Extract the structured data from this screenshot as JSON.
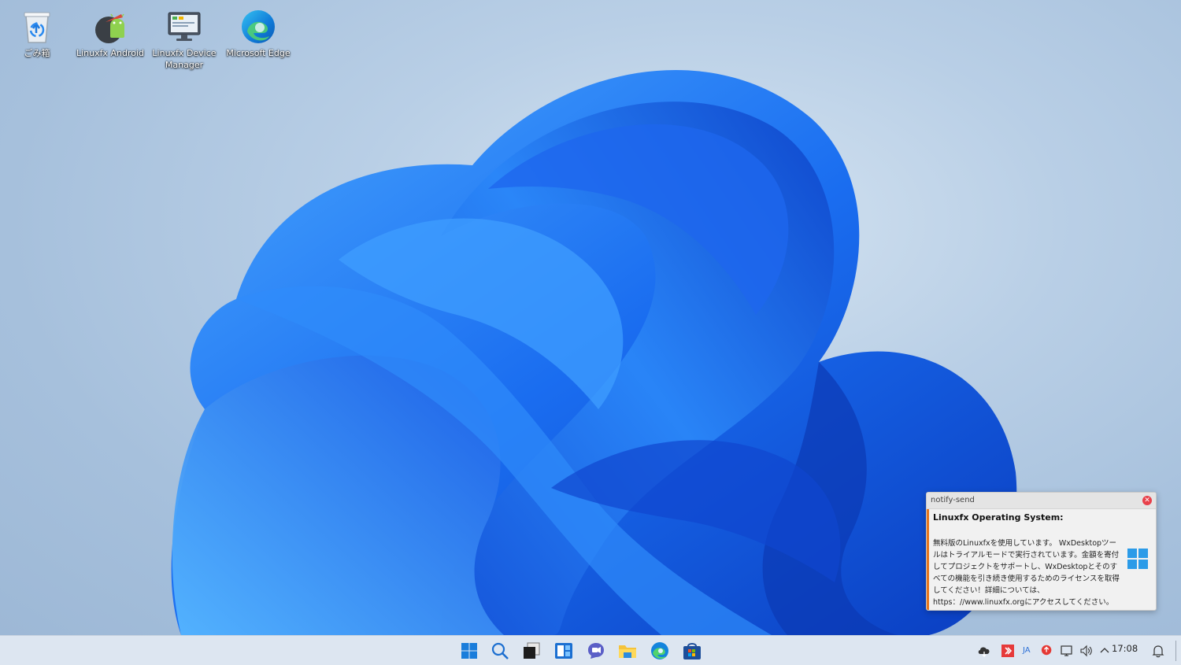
{
  "desktop": {
    "icons": [
      {
        "label": "ごみ箱",
        "icon": "recycle-bin-icon"
      },
      {
        "label": "Linuxfx Android",
        "icon": "android-icon"
      },
      {
        "label": "Linuxfx Device Manager",
        "icon": "monitor-icon"
      },
      {
        "label": "Microsoft Edge",
        "icon": "edge-icon"
      }
    ]
  },
  "notification": {
    "app_name": "notify-send",
    "title": "Linuxfx Operating System:",
    "body": "無料版のLinuxfxを使用しています。 WxDesktopツールはトライアルモードで実行されています。金額を寄付してプロジェクトをサポートし、WxDesktopとそのすべての機能を引き続き使用するためのライセンスを取得してください！詳細については、https：//www.linuxfx.orgにアクセスしてください。",
    "accent_color": "#e8761c",
    "close_icon": "close-icon",
    "logo_icon": "windows-logo-icon"
  },
  "taskbar": {
    "apps": [
      {
        "name": "start",
        "icon": "windows-logo-icon"
      },
      {
        "name": "search",
        "icon": "search-icon"
      },
      {
        "name": "task-view",
        "icon": "task-view-icon"
      },
      {
        "name": "widgets",
        "icon": "widgets-icon"
      },
      {
        "name": "chat",
        "icon": "chat-icon"
      },
      {
        "name": "file-explorer",
        "icon": "folder-icon"
      },
      {
        "name": "edge",
        "icon": "edge-icon"
      },
      {
        "name": "store",
        "icon": "store-icon"
      }
    ],
    "tray": {
      "language": "JA",
      "clock": "17:08"
    }
  }
}
